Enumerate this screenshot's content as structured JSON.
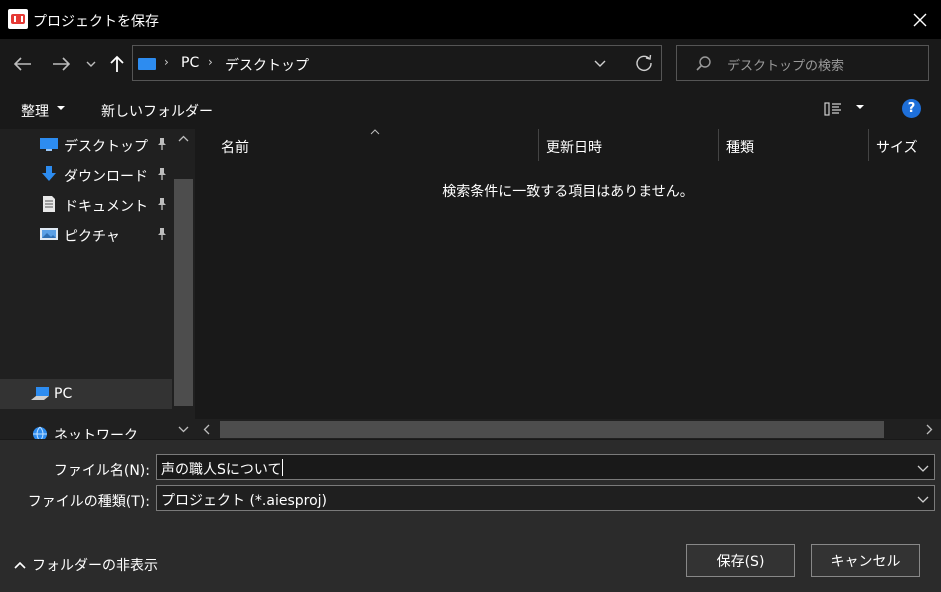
{
  "window": {
    "title": "プロジェクトを保存",
    "close_icon": "close-icon"
  },
  "nav": {
    "back_icon": "arrow-left-icon",
    "forward_icon": "arrow-right-icon",
    "recent_icon": "chevron-down-icon",
    "up_icon": "arrow-up-icon",
    "breadcrumb": [
      "PC",
      "デスクトップ"
    ],
    "search_placeholder": "デスクトップの検索"
  },
  "toolbar": {
    "organize_label": "整理",
    "new_folder_label": "新しいフォルダー"
  },
  "sidebar": {
    "quick_access": [
      {
        "label": "デスクトップ",
        "icon": "desktop-icon"
      },
      {
        "label": "ダウンロード",
        "icon": "download-icon"
      },
      {
        "label": "ドキュメント",
        "icon": "document-icon"
      },
      {
        "label": "ピクチャ",
        "icon": "picture-icon"
      }
    ],
    "pc_label": "PC",
    "network_label": "ネットワーク"
  },
  "file_list": {
    "columns": [
      "名前",
      "更新日時",
      "種類",
      "サイズ"
    ],
    "empty_message": "検索条件に一致する項目はありません。"
  },
  "form": {
    "filename_label": "ファイル名(N):",
    "filename_value": "声の職人Sについて",
    "filetype_label": "ファイルの種類(T):",
    "filetype_value": "プロジェクト (*.aiesproj)",
    "save_label": "保存(S)",
    "cancel_label": "キャンセル",
    "hide_folders_label": "フォルダーの非表示"
  },
  "colors": {
    "accent": "#2d8cf0",
    "background": "#191919",
    "titlebar": "#000000"
  }
}
